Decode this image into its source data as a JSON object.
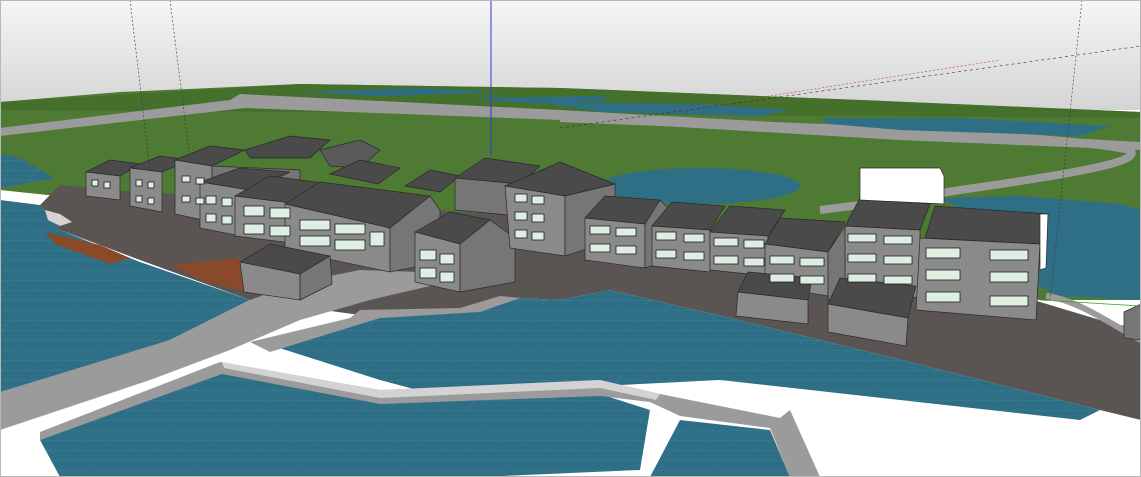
{
  "viewport": {
    "style": "sketchup-3d-model-view",
    "colors": {
      "sky_top": "#f6f6f6",
      "sky_bottom": "#d4d4d4",
      "grass": "#4f7a33",
      "grass_far": "#44702c",
      "water": "#2f6f86",
      "water_grid": "#3f8aa3",
      "path_gray": "#9b9b9b",
      "path_edge": "#d3d3d3",
      "plaza": "#5a5552",
      "wall": "#8a8a8a",
      "wall_dark": "#767676",
      "roof": "#4a4a4a",
      "roof_light": "#5a5a5a",
      "window": "#dfeee2",
      "white_box": "#ffffff",
      "deck": "#8a4a2a",
      "axis_blue": "#2c3cd9",
      "axis_red": "#c34040",
      "axis_green": "#2ea02e"
    }
  }
}
